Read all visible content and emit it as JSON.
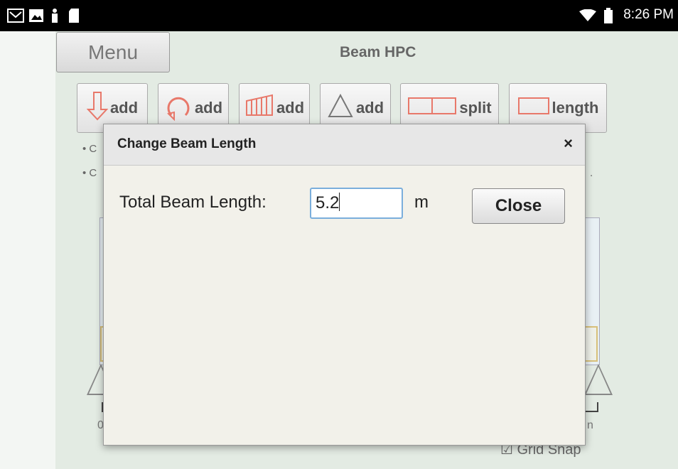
{
  "status_bar": {
    "time": "8:26 PM",
    "icons": [
      "gmail-icon",
      "image-icon",
      "figure-icon",
      "sd-card-icon",
      "wifi-icon",
      "battery-icon"
    ]
  },
  "app": {
    "menu_label": "Menu",
    "title": "Beam HPC"
  },
  "toolbar": {
    "buttons": [
      {
        "label": "add",
        "icon": "point-load-icon"
      },
      {
        "label": "add",
        "icon": "moment-icon"
      },
      {
        "label": "add",
        "icon": "distributed-load-icon"
      },
      {
        "label": "add",
        "icon": "support-icon"
      },
      {
        "label": "split",
        "icon": "split-beam-icon"
      },
      {
        "label": "length",
        "icon": "beam-length-icon"
      }
    ]
  },
  "background": {
    "bullet1": "• C",
    "bullet2": "• C",
    "bullet2_tail": ".",
    "left_tick": "0",
    "right_tick": "n",
    "grid_snap_label": "Grid Snap",
    "grid_snap_checked": "☑"
  },
  "dialog": {
    "title": "Change Beam Length",
    "close_x": "×",
    "field_label": "Total Beam Length:",
    "field_value": "5.2",
    "unit": "m",
    "close_button": "Close"
  },
  "colors": {
    "accent_red": "#e8786a",
    "input_focus": "#7aaedc",
    "background": "#e3ebe3"
  }
}
